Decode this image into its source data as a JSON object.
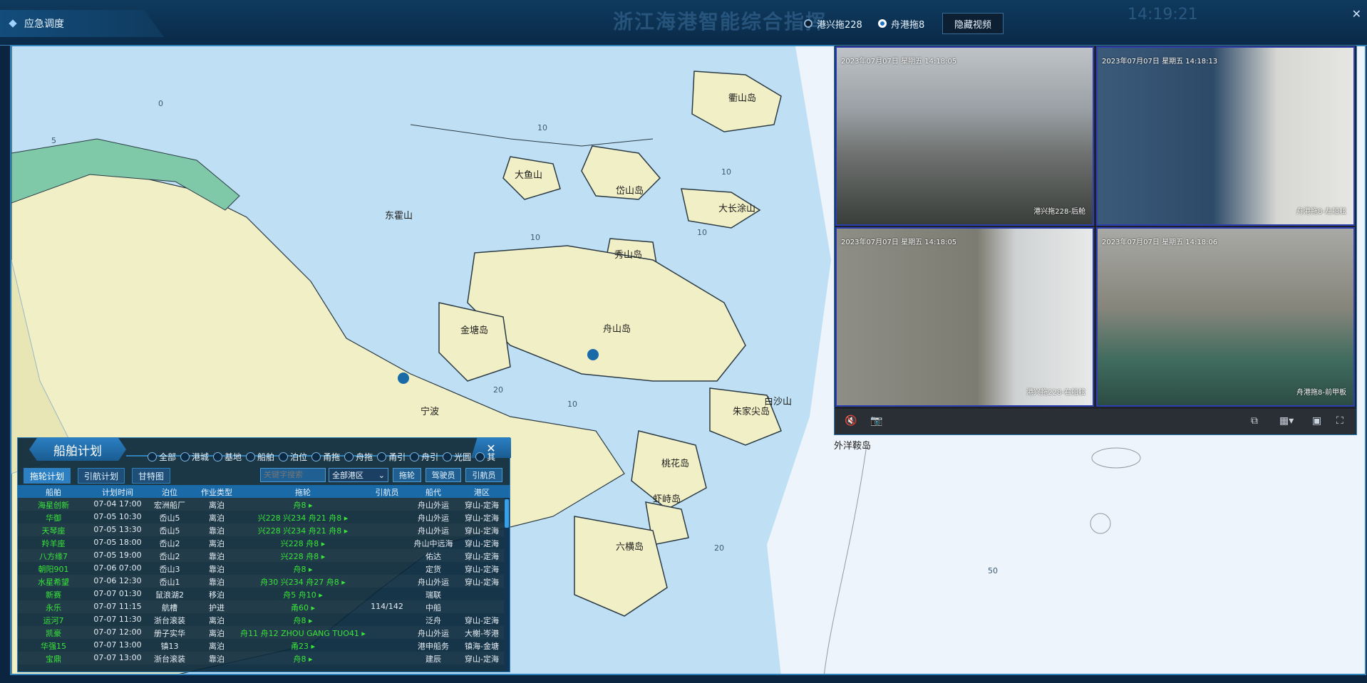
{
  "window": {
    "title": "应急调度",
    "center_title": "浙江海港智能综合指挥",
    "clock": "14:19:21"
  },
  "camera_selector": {
    "options": [
      {
        "label": "港兴拖228",
        "selected": false
      },
      {
        "label": "舟港拖8",
        "selected": true
      }
    ],
    "hide_video_label": "隐藏视频"
  },
  "map": {
    "places": [
      "衢山岛",
      "岱山岛",
      "东霍山",
      "大鱼山",
      "大长涂山",
      "秀山岛",
      "金塘岛",
      "舟山岛",
      "宁波",
      "朱家尖岛",
      "白沙山",
      "桃花岛",
      "虾峙岛",
      "六横岛",
      "外洋鞍岛"
    ],
    "depths": [
      "0",
      "5",
      "10",
      "10",
      "10",
      "10",
      "10",
      "20",
      "20",
      "50"
    ]
  },
  "video": {
    "cams": [
      {
        "timestamp": "2023年07月07日 星期五 14:18:05",
        "name": "港兴拖228-后舱"
      },
      {
        "timestamp": "2023年07月07日 星期五 14:18:13",
        "name": "舟港拖8-左船舷"
      },
      {
        "timestamp": "2023年07月07日 星期五 14:18:05",
        "name": "港兴拖228-右船舷"
      },
      {
        "timestamp": "2023年07月07日 星期五 14:18:06",
        "name": "舟港拖8-前甲板"
      }
    ]
  },
  "plan": {
    "title": "船舶计划",
    "close": "✕",
    "filters": [
      "全部",
      "港城",
      "基地",
      "船舶",
      "泊位",
      "甬拖",
      "舟拖",
      "甬引",
      "舟引",
      "光圆",
      "其"
    ],
    "tabs": [
      "拖轮计划",
      "引航计划",
      "甘特图"
    ],
    "search_placeholder": "关键字搜索",
    "area_select": "全部港区",
    "buttons": [
      "拖轮",
      "驾驶员",
      "引航员"
    ],
    "columns": [
      "船舶",
      "计划时间",
      "泊位",
      "作业类型",
      "拖轮",
      "引航员",
      "船代",
      "港区"
    ],
    "rows": [
      [
        "海星创新",
        "07-04 17:00",
        "宏洲船厂",
        "离泊",
        "舟8 ▸",
        "",
        "舟山外运",
        "穿山-定海"
      ],
      [
        "华御",
        "07-05 10:30",
        "岙山5",
        "离泊",
        "兴228 兴234 舟21 舟8 ▸",
        "",
        "舟山外运",
        "穿山-定海"
      ],
      [
        "天琴座",
        "07-05 13:30",
        "岙山5",
        "靠泊",
        "兴228 兴234 舟21 舟8 ▸",
        "",
        "舟山外运",
        "穿山-定海"
      ],
      [
        "羚羊座",
        "07-05 18:00",
        "岙山2",
        "离泊",
        "兴228 舟8 ▸",
        "",
        "舟山中远海",
        "穿山-定海"
      ],
      [
        "八方缘7",
        "07-05 19:00",
        "岙山2",
        "靠泊",
        "兴228 舟8 ▸",
        "",
        "佑达",
        "穿山-定海"
      ],
      [
        "朝阳901",
        "07-06 07:00",
        "岙山3",
        "靠泊",
        "舟8 ▸",
        "",
        "定货",
        "穿山-定海"
      ],
      [
        "水星希望",
        "07-06 12:30",
        "岙山1",
        "靠泊",
        "舟30 兴234 舟27 舟8 ▸",
        "",
        "舟山外运",
        "穿山-定海"
      ],
      [
        "新赛",
        "07-07 01:30",
        "鼠浪湖2",
        "移泊",
        "舟5 舟10 ▸",
        "",
        "瑞联",
        ""
      ],
      [
        "永乐",
        "07-07 11:15",
        "航槽",
        "护进",
        "甬60 ▸",
        "114/142",
        "中船",
        ""
      ],
      [
        "运河7",
        "07-07 11:30",
        "浙台滚装",
        "离泊",
        "舟8 ▸",
        "",
        "泛舟",
        "穿山-定海"
      ],
      [
        "凯豪",
        "07-07 12:00",
        "册子实华",
        "离泊",
        "舟11 舟12 ZHOU GANG TUO41 ▸",
        "",
        "舟山外运",
        "大榭-岑港"
      ],
      [
        "华强15",
        "07-07 13:00",
        "镇13",
        "离泊",
        "甬23 ▸",
        "",
        "港申船务",
        "镇海-金塘"
      ],
      [
        "宝鼎",
        "07-07 13:00",
        "浙台滚装",
        "靠泊",
        "舟8 ▸",
        "",
        "建辰",
        "穿山-定海"
      ]
    ]
  }
}
